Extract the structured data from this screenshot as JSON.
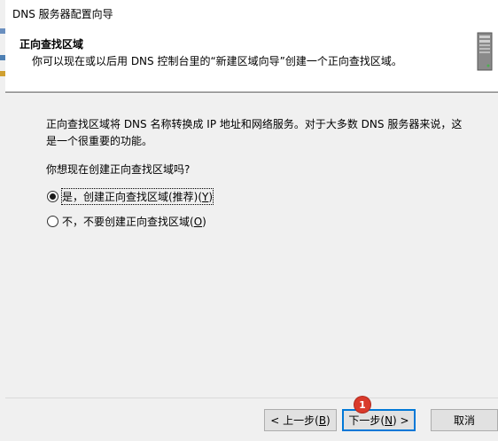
{
  "window": {
    "title": "DNS 服务器配置向导"
  },
  "header": {
    "title": "正向查找区域",
    "subtitle": "你可以现在或以后用 DNS 控制台里的“新建区域向导”创建一个正向查找区域。",
    "icon": "server-icon"
  },
  "content": {
    "description_line1": "正向查找区域将 DNS 名称转换成 IP 地址和网络服务。对于大多数 DNS 服务器来说，这",
    "description_line2": "是一个很重要的功能。",
    "question": "你想现在创建正向查找区域吗?",
    "options": [
      {
        "label_main": "是，创建正向查找区域(推荐)(",
        "accel": "Y",
        "label_end": ")",
        "selected": true
      },
      {
        "label_main": "不，不要创建正向查找区域(",
        "accel": "O",
        "label_end": ")",
        "selected": false
      }
    ]
  },
  "buttons": {
    "back": {
      "pre": "< 上一步(",
      "accel": "B",
      "post": ")"
    },
    "next": {
      "pre": "下一步(",
      "accel": "N",
      "post": ") >"
    },
    "cancel": "取消"
  },
  "annotation": {
    "badge_number": "1",
    "color": "#d93a2b"
  }
}
